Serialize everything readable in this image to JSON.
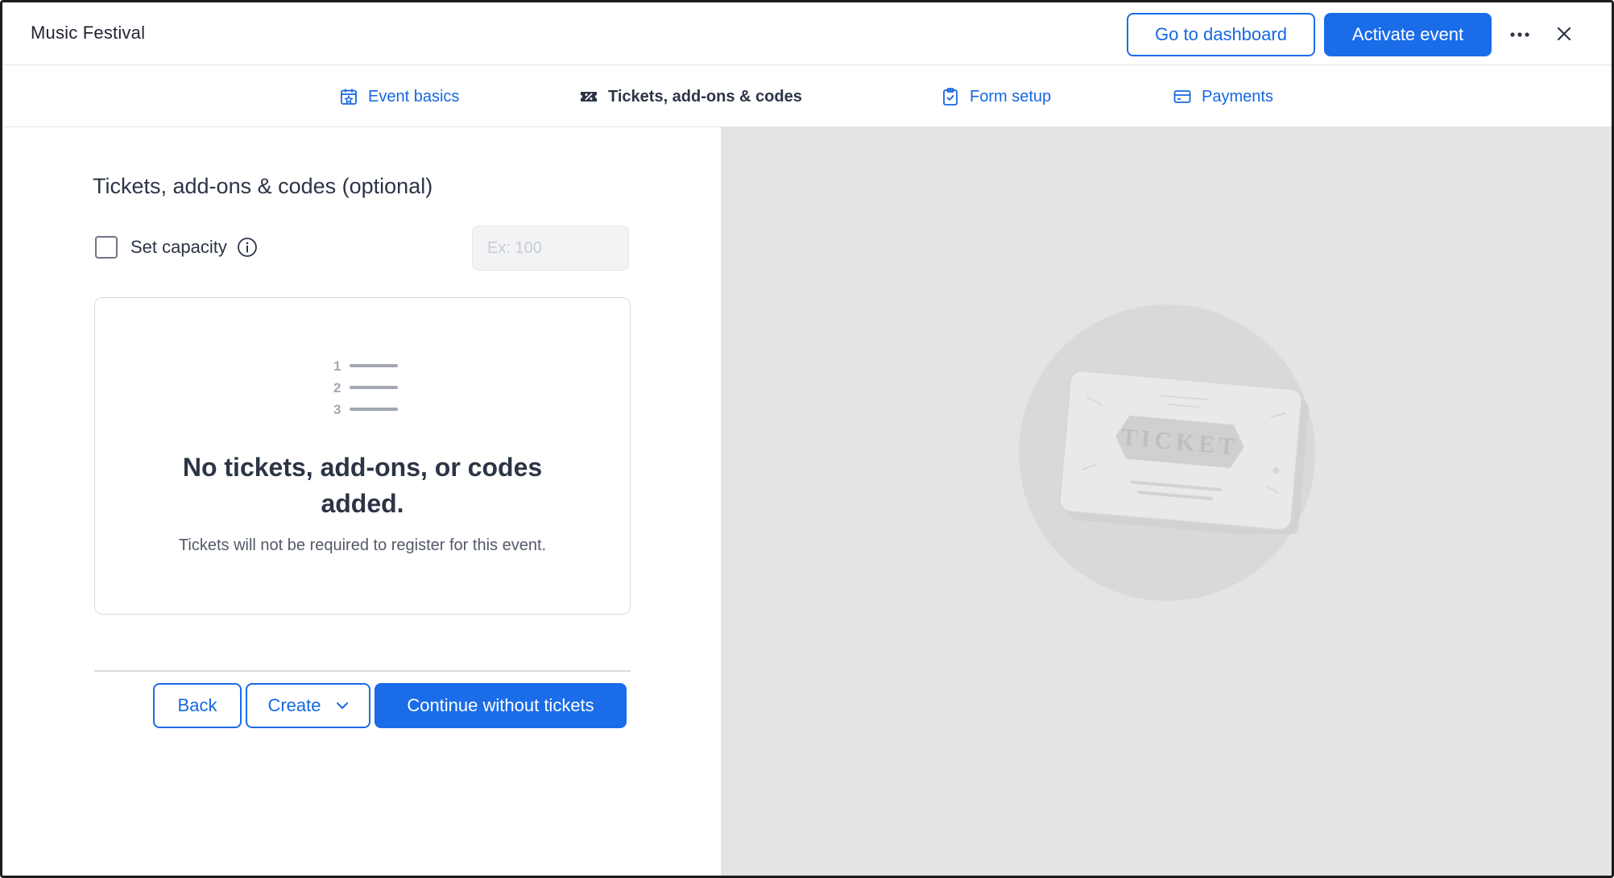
{
  "header": {
    "app_title": "Music Festival",
    "dashboard_label": "Go to dashboard",
    "activate_label": "Activate event",
    "more_icon": "more-horizontal-icon",
    "close_icon": "close-icon"
  },
  "tabs": [
    {
      "label": "Event basics",
      "icon": "calendar-star-icon",
      "active": false
    },
    {
      "label": "Tickets, add-ons & codes",
      "icon": "ticket-percent-icon",
      "active": true
    },
    {
      "label": "Form setup",
      "icon": "clipboard-check-icon",
      "active": false
    },
    {
      "label": "Payments",
      "icon": "credit-card-icon",
      "active": false
    }
  ],
  "main": {
    "section_title": "Tickets, add-ons & codes (optional)",
    "capacity": {
      "label": "Set capacity",
      "checked": false,
      "placeholder": "Ex: 100",
      "value": ""
    },
    "empty_state": {
      "list_numbers": [
        "1",
        "2",
        "3"
      ],
      "heading": "No tickets, add-ons, or codes added.",
      "subtext": "Tickets will not be required to register for this event."
    },
    "actions": {
      "back_label": "Back",
      "create_label": "Create",
      "continue_label": "Continue without tickets"
    }
  },
  "illustration": {
    "ticket_text": "TICKET"
  },
  "colors": {
    "primary": "#1a6ce8",
    "text": "#2c3446",
    "panel_gray": "#e4e4e4"
  }
}
